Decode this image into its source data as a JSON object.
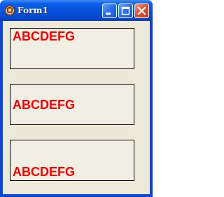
{
  "window": {
    "title": "Form1",
    "controls": {
      "minimize_icon": "minimize-icon",
      "maximize_icon": "maximize-icon",
      "close_icon": "close-icon"
    }
  },
  "labels": [
    {
      "text": "ABCDEFG",
      "align": "top"
    },
    {
      "text": "ABCDEFG",
      "align": "middle"
    },
    {
      "text": "ABCDEFG",
      "align": "bottom"
    }
  ],
  "colors": {
    "label_text": "#ff0000",
    "client_bg": "#ece9d8",
    "titlebar": "#0650dc"
  }
}
